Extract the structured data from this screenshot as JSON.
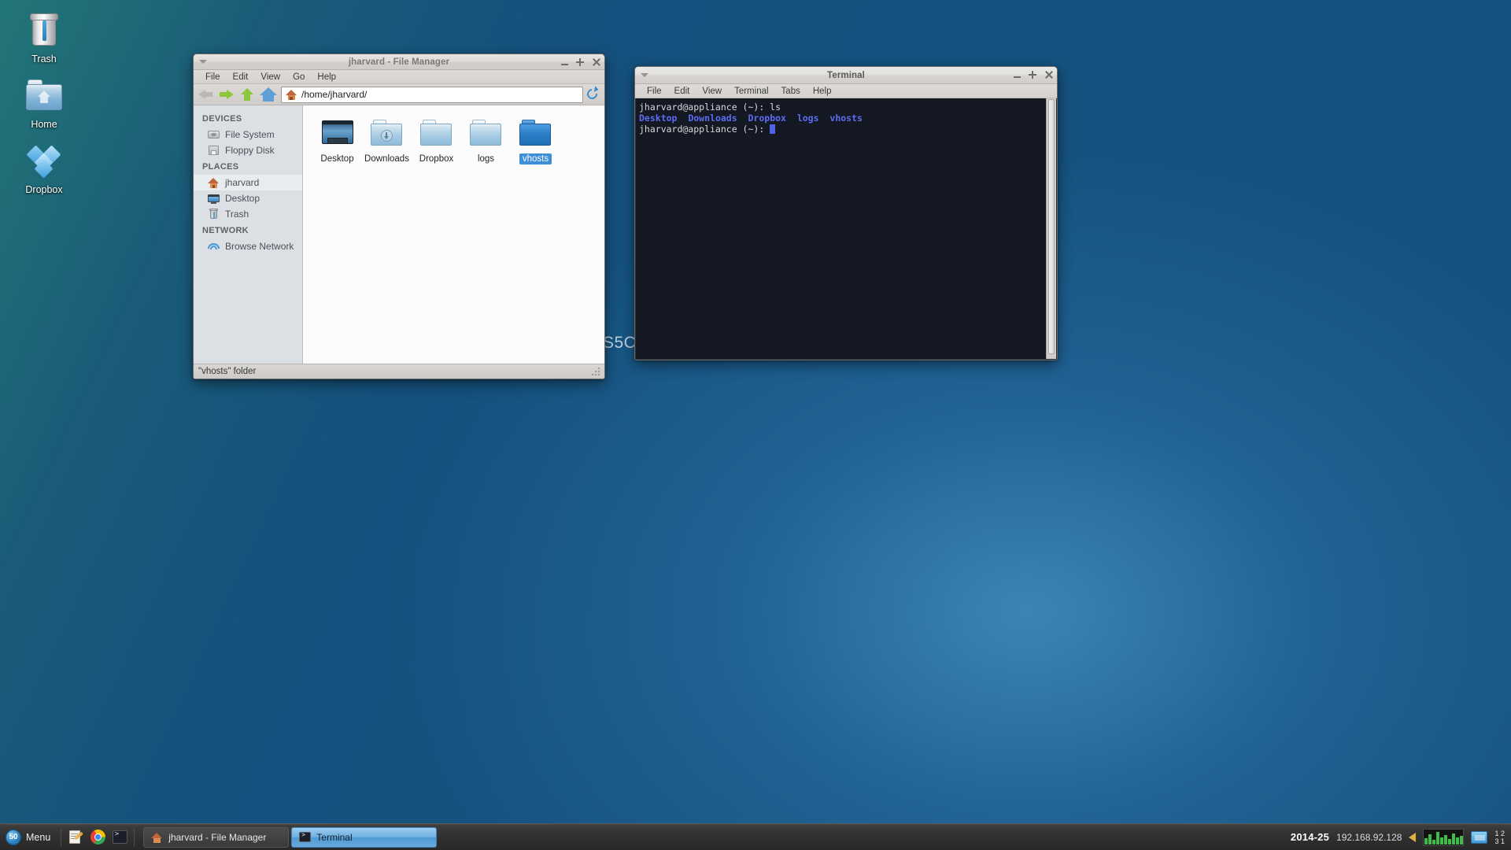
{
  "desktop": {
    "icons": [
      {
        "label": "Trash",
        "icon": "trash-icon"
      },
      {
        "label": "Home",
        "icon": "home-folder-icon"
      },
      {
        "label": "Dropbox",
        "icon": "dropbox-icon"
      }
    ],
    "background_text": "S5C"
  },
  "file_manager": {
    "title": "jharvard - File Manager",
    "menus": [
      "File",
      "Edit",
      "View",
      "Go",
      "Help"
    ],
    "toolbar": {
      "back_icon": "back-arrow-icon",
      "forward_icon": "forward-arrow-icon",
      "up_icon": "up-arrow-icon",
      "home_icon": "home-icon",
      "path_value": "/home/jharvard/",
      "path_placeholder": "/home/jharvard/",
      "reload_icon": "reload-icon"
    },
    "sidebar": [
      {
        "heading": "DEVICES",
        "items": [
          {
            "label": "File System",
            "icon": "drive-icon",
            "selected": false
          },
          {
            "label": "Floppy Disk",
            "icon": "floppy-icon",
            "selected": false
          }
        ]
      },
      {
        "heading": "PLACES",
        "items": [
          {
            "label": "jharvard",
            "icon": "home-icon",
            "selected": true
          },
          {
            "label": "Desktop",
            "icon": "monitor-icon",
            "selected": false
          },
          {
            "label": "Trash",
            "icon": "trash-icon",
            "selected": false
          }
        ]
      },
      {
        "heading": "NETWORK",
        "items": [
          {
            "label": "Browse Network",
            "icon": "wifi-icon",
            "selected": false
          }
        ]
      }
    ],
    "files": [
      {
        "label": "Desktop",
        "type": "monitor",
        "selected": false
      },
      {
        "label": "Downloads",
        "type": "folder-download",
        "selected": false
      },
      {
        "label": "Dropbox",
        "type": "folder",
        "selected": false
      },
      {
        "label": "logs",
        "type": "folder",
        "selected": false
      },
      {
        "label": "vhosts",
        "type": "folder",
        "selected": true
      }
    ],
    "status_text": "\"vhosts\" folder",
    "window_buttons": {
      "minimize": "minimize-icon",
      "maximize": "maximize-icon",
      "close": "close-icon"
    }
  },
  "terminal": {
    "title": "Terminal",
    "menus": [
      "File",
      "Edit",
      "View",
      "Terminal",
      "Tabs",
      "Help"
    ],
    "lines": [
      {
        "prompt": "jharvard@appliance (~): ",
        "command": "ls",
        "dirs": []
      },
      {
        "prompt": "",
        "command": "",
        "dirs": [
          "Desktop",
          "Downloads",
          "Dropbox",
          "logs",
          "vhosts"
        ]
      },
      {
        "prompt": "jharvard@appliance (~): ",
        "command": "",
        "dirs": [],
        "cursor": true
      }
    ],
    "window_buttons": {
      "minimize": "minimize-icon",
      "maximize": "maximize-icon",
      "close": "close-icon"
    }
  },
  "taskbar": {
    "menu_label": "Menu",
    "menu_logo_text": "50",
    "launchers": [
      {
        "name": "text-editor-launcher"
      },
      {
        "name": "chrome-launcher"
      },
      {
        "name": "terminal-launcher"
      }
    ],
    "windows": [
      {
        "label": "jharvard - File Manager",
        "icon": "home-icon",
        "active": false
      },
      {
        "label": "Terminal",
        "icon": "terminal-icon",
        "active": true
      }
    ],
    "tray": {
      "clock": "2014-25",
      "ip": "192.168.92.128",
      "arrow_icon": "left-arrow-icon",
      "graph_icon": "cpu-graph-icon",
      "network_icon": "network-icon",
      "net_up": "1",
      "net_down": "3",
      "net_up2": "2",
      "net_down2": "1"
    }
  },
  "colors": {
    "selection_blue": "#3d8fd8",
    "terminal_bg": "#141822",
    "terminal_dir": "#5c6cf2",
    "accent_green": "#8cc63f"
  }
}
